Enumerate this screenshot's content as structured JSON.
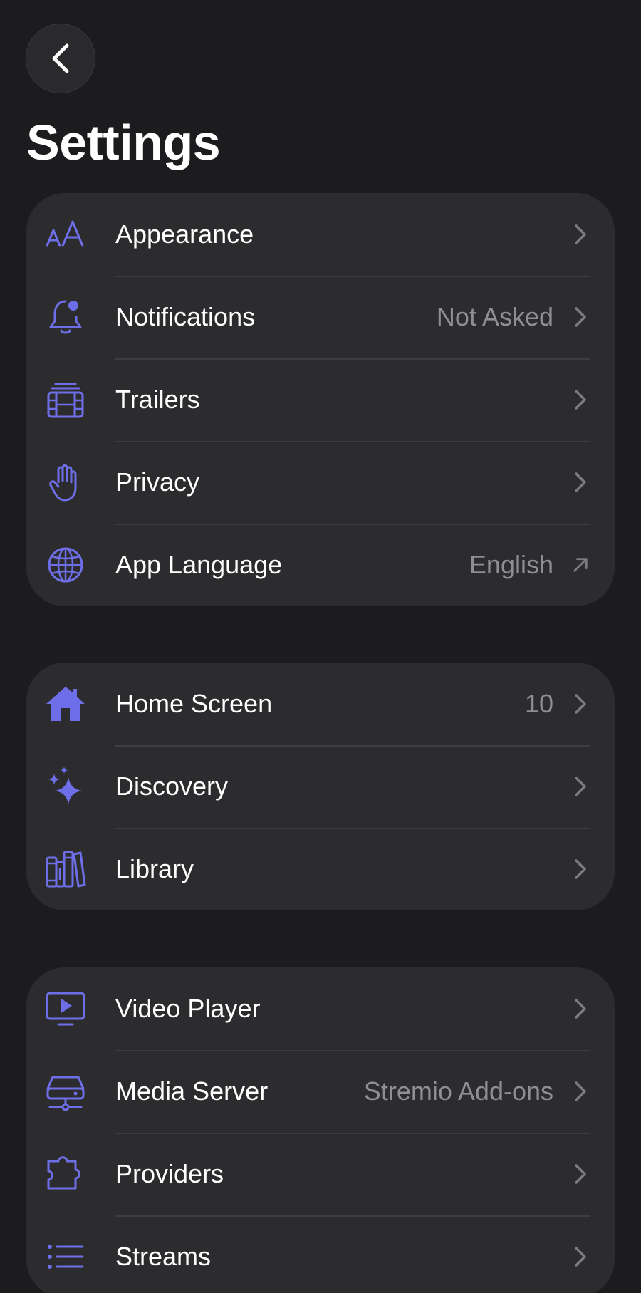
{
  "header": {
    "title": "Settings"
  },
  "colors": {
    "background": "#1c1c1e",
    "card": "#2c2c2e",
    "accent": "#6e6fe8",
    "secondary_text": "#8e8e93",
    "chevron": "#7c7c80"
  },
  "groups": [
    {
      "items": [
        {
          "label": "Appearance",
          "value": "",
          "icon": "text-size-icon",
          "trailing": "chevron"
        },
        {
          "label": "Notifications",
          "value": "Not Asked",
          "icon": "bell-badge-icon",
          "trailing": "chevron"
        },
        {
          "label": "Trailers",
          "value": "",
          "icon": "film-stack-icon",
          "trailing": "chevron"
        },
        {
          "label": "Privacy",
          "value": "",
          "icon": "hand-raised-icon",
          "trailing": "chevron"
        },
        {
          "label": "App Language",
          "value": "English",
          "icon": "globe-icon",
          "trailing": "external-arrow"
        }
      ]
    },
    {
      "items": [
        {
          "label": "Home Screen",
          "value": "10",
          "icon": "house-icon",
          "trailing": "chevron"
        },
        {
          "label": "Discovery",
          "value": "",
          "icon": "sparkles-icon",
          "trailing": "chevron"
        },
        {
          "label": "Library",
          "value": "",
          "icon": "books-icon",
          "trailing": "chevron"
        }
      ]
    },
    {
      "items": [
        {
          "label": "Video Player",
          "value": "",
          "icon": "play-display-icon",
          "trailing": "chevron"
        },
        {
          "label": "Media Server",
          "value": "Stremio Add-ons",
          "icon": "server-icon",
          "trailing": "chevron"
        },
        {
          "label": "Providers",
          "value": "",
          "icon": "puzzle-piece-icon",
          "trailing": "chevron"
        },
        {
          "label": "Streams",
          "value": "",
          "icon": "list-bullet-icon",
          "trailing": "chevron"
        }
      ]
    }
  ]
}
